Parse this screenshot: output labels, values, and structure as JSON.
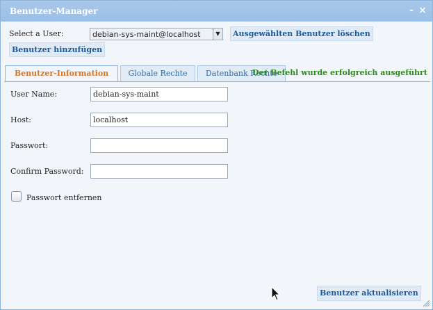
{
  "window": {
    "title": "Benutzer-Manager",
    "minimize_label": "-",
    "close_label": "×"
  },
  "user_select": {
    "label": "Select a User:",
    "selected_value": "debian-sys-maint@localhost",
    "arrow_icon": "chevron-down-icon"
  },
  "actions": {
    "delete_label": "Ausgewählten Benutzer löschen",
    "add_label": "Benutzer hinzufügen",
    "update_label": "Benutzer aktualisieren"
  },
  "tabs": [
    {
      "label": "Benutzer-Information",
      "active": true
    },
    {
      "label": "Globale Rechte",
      "active": false
    },
    {
      "label": "Datenbank Rechte",
      "active": false
    }
  ],
  "status_message": "Der Befehl wurde erfolgreich ausgeführt",
  "form": {
    "username": {
      "label": "User Name:",
      "value": "debian-sys-maint"
    },
    "host": {
      "label": "Host:",
      "value": "localhost"
    },
    "password": {
      "label": "Passwort:",
      "value": ""
    },
    "confirm_password": {
      "label": "Confirm Password:",
      "value": ""
    },
    "remove_password": {
      "label": "Passwort entfernen",
      "checked": false
    }
  },
  "colors": {
    "titlebar": "#9bbfe6",
    "active_tab": "#d9741f",
    "status": "#2e8a1c",
    "button_text": "#1e5a96"
  }
}
